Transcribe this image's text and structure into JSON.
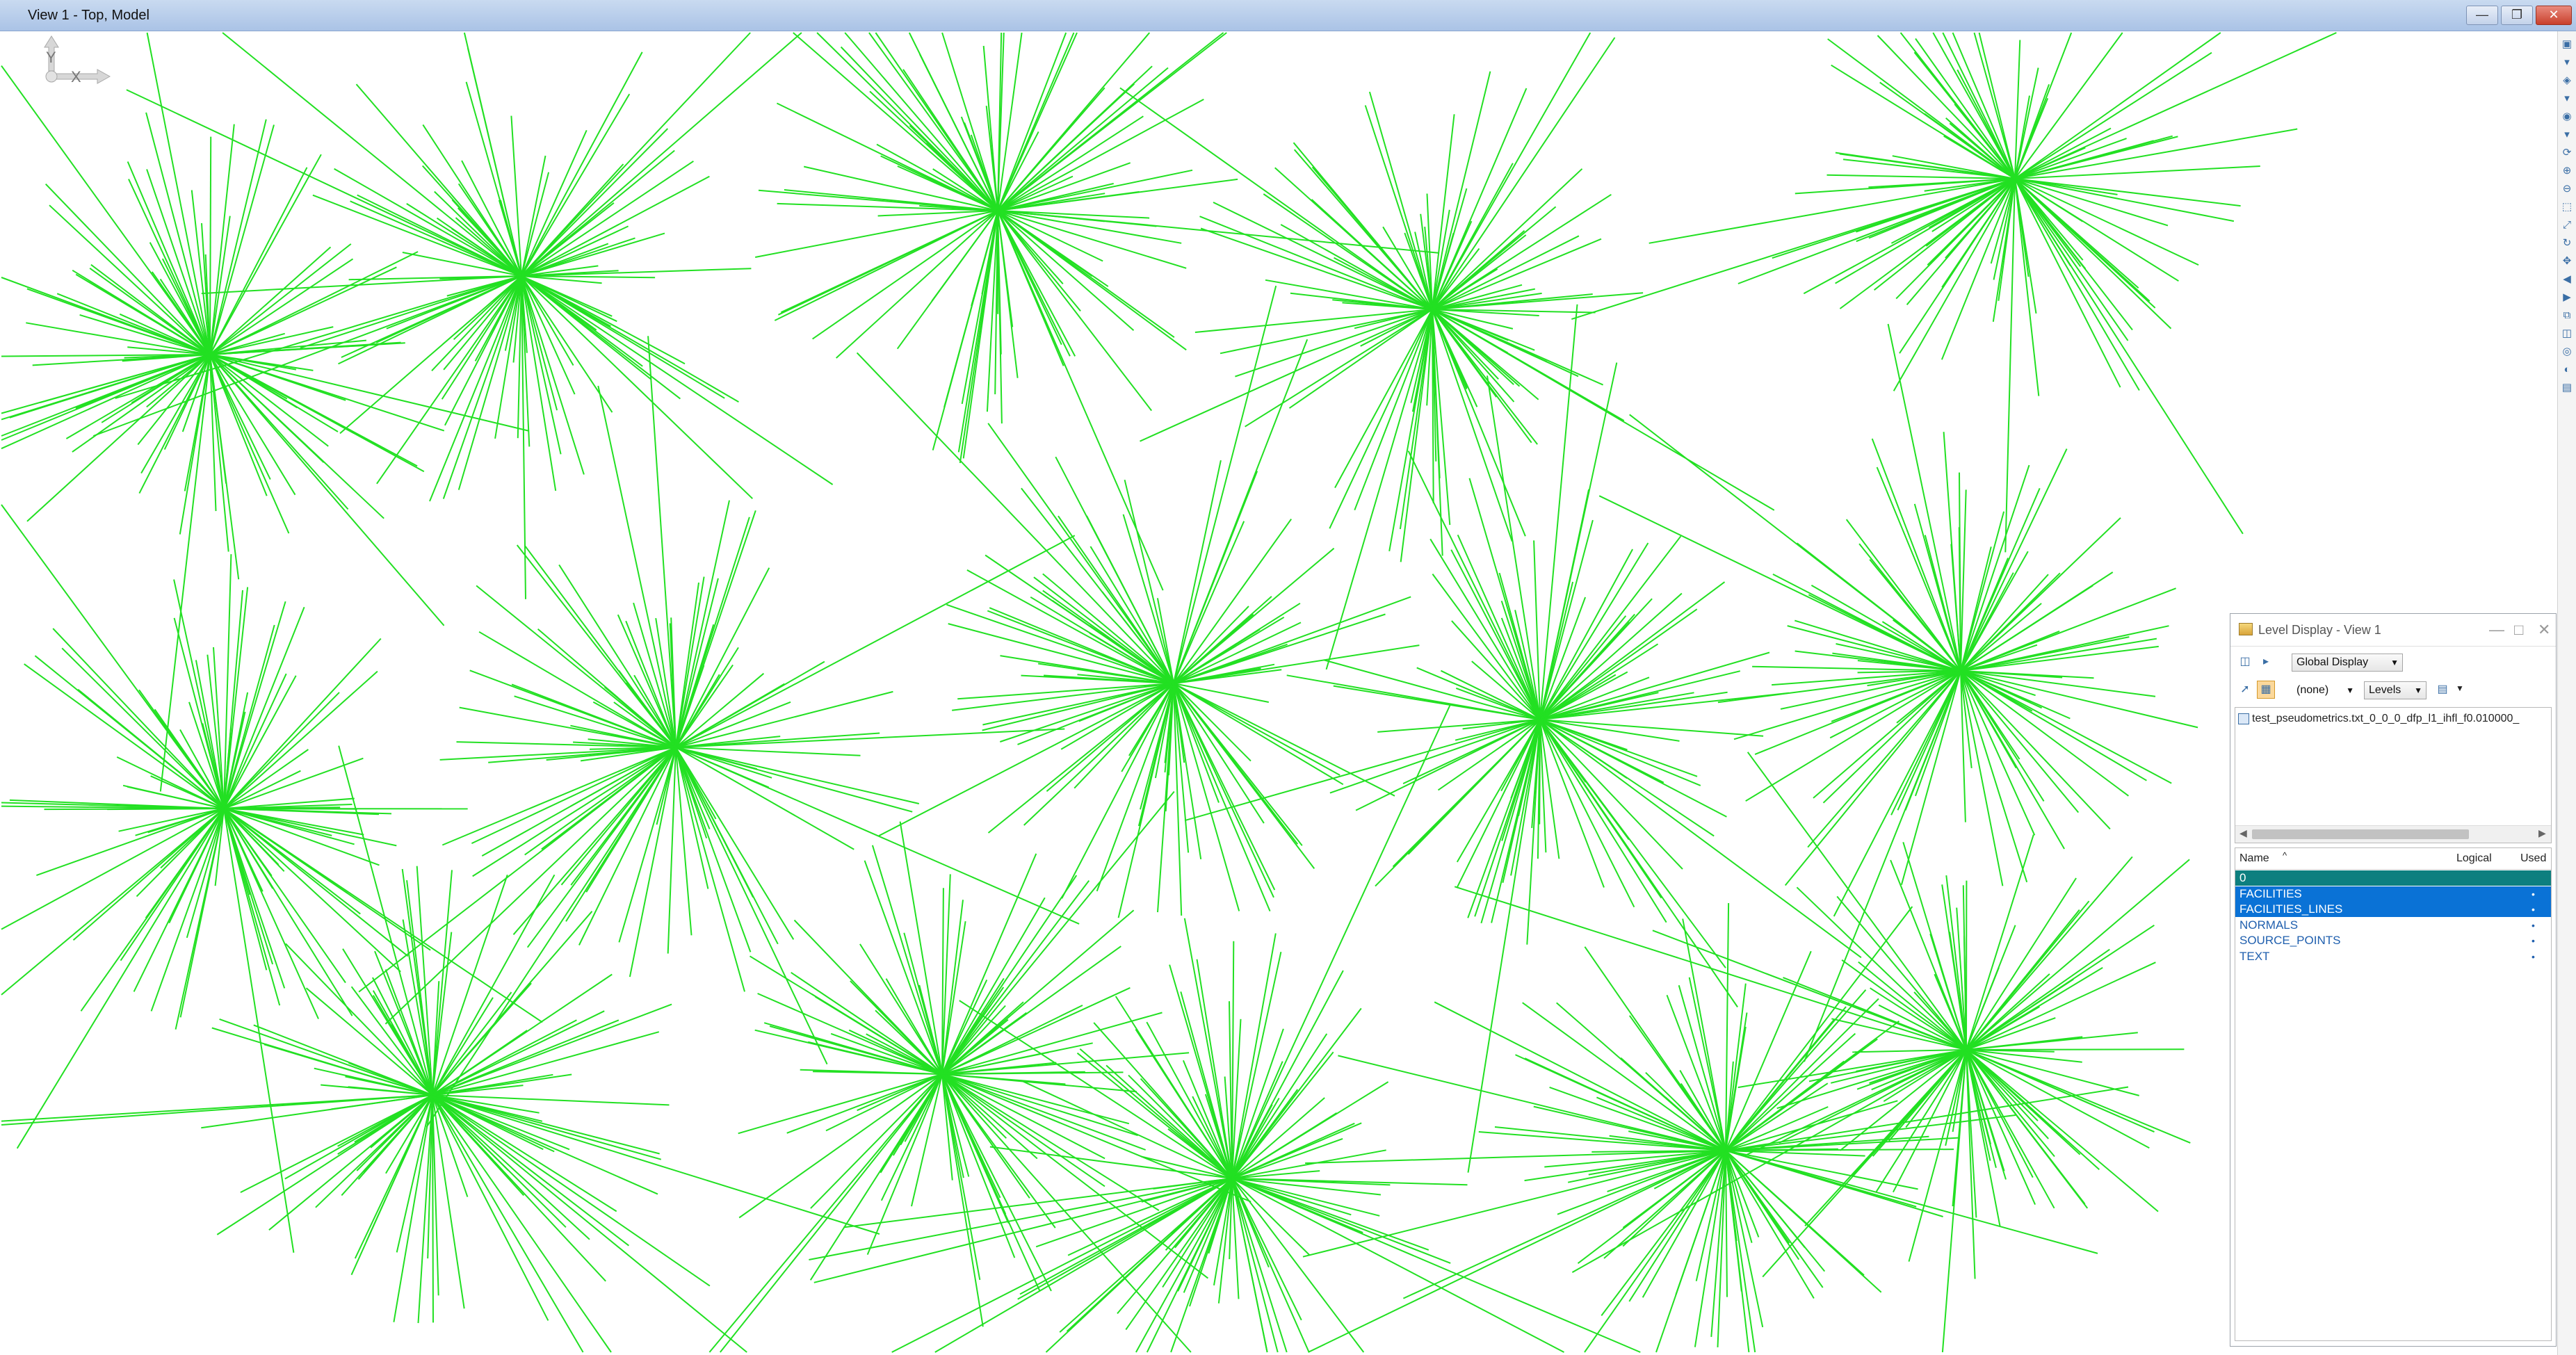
{
  "window": {
    "title": "View 1 - Top, Model",
    "minimize_icon": "minimize-icon",
    "restore_icon": "restore-icon",
    "close_icon": "close-icon"
  },
  "triad": {
    "y_label": "Y",
    "x_label": "X"
  },
  "toolstrip": {
    "icons": [
      "view-attributes-icon",
      "dropdown-icon",
      "level-display-icon",
      "dropdown-icon",
      "display-style-icon",
      "dropdown-icon",
      "update-view-icon",
      "zoom-in-icon",
      "zoom-out-icon",
      "window-area-icon",
      "fit-view-icon",
      "rotate-view-icon",
      "pan-view-icon",
      "view-previous-icon",
      "view-next-icon",
      "copy-view-icon",
      "clip-volume-icon",
      "camera-icon",
      "render-icon",
      "presentation-icon"
    ]
  },
  "level_display": {
    "title": "Level Display - View 1",
    "display_mode": "Global Display",
    "symbology_filter": "(none)",
    "view_mode": "Levels",
    "file_entry": "test_pseudometrics.txt_0_0_0_dfp_l1_ihfl_f0.010000_",
    "columns": {
      "name": "Name",
      "sort_indicator": "^",
      "logical": "Logical",
      "used": "Used"
    },
    "levels": [
      {
        "name": "0",
        "used": "",
        "state": "active"
      },
      {
        "name": "FACILITIES",
        "used": "•",
        "state": "selected"
      },
      {
        "name": "FACILITIES_LINES",
        "used": "•",
        "state": "selected"
      },
      {
        "name": "NORMALS",
        "used": "•",
        "state": "normal"
      },
      {
        "name": "SOURCE_POINTS",
        "used": "•",
        "state": "normal"
      },
      {
        "name": "TEXT",
        "used": "•",
        "state": "normal"
      }
    ]
  },
  "colors": {
    "line_color": "#22e022",
    "selected_row": "#0a72d6",
    "active_row": "#0d7f7f"
  }
}
